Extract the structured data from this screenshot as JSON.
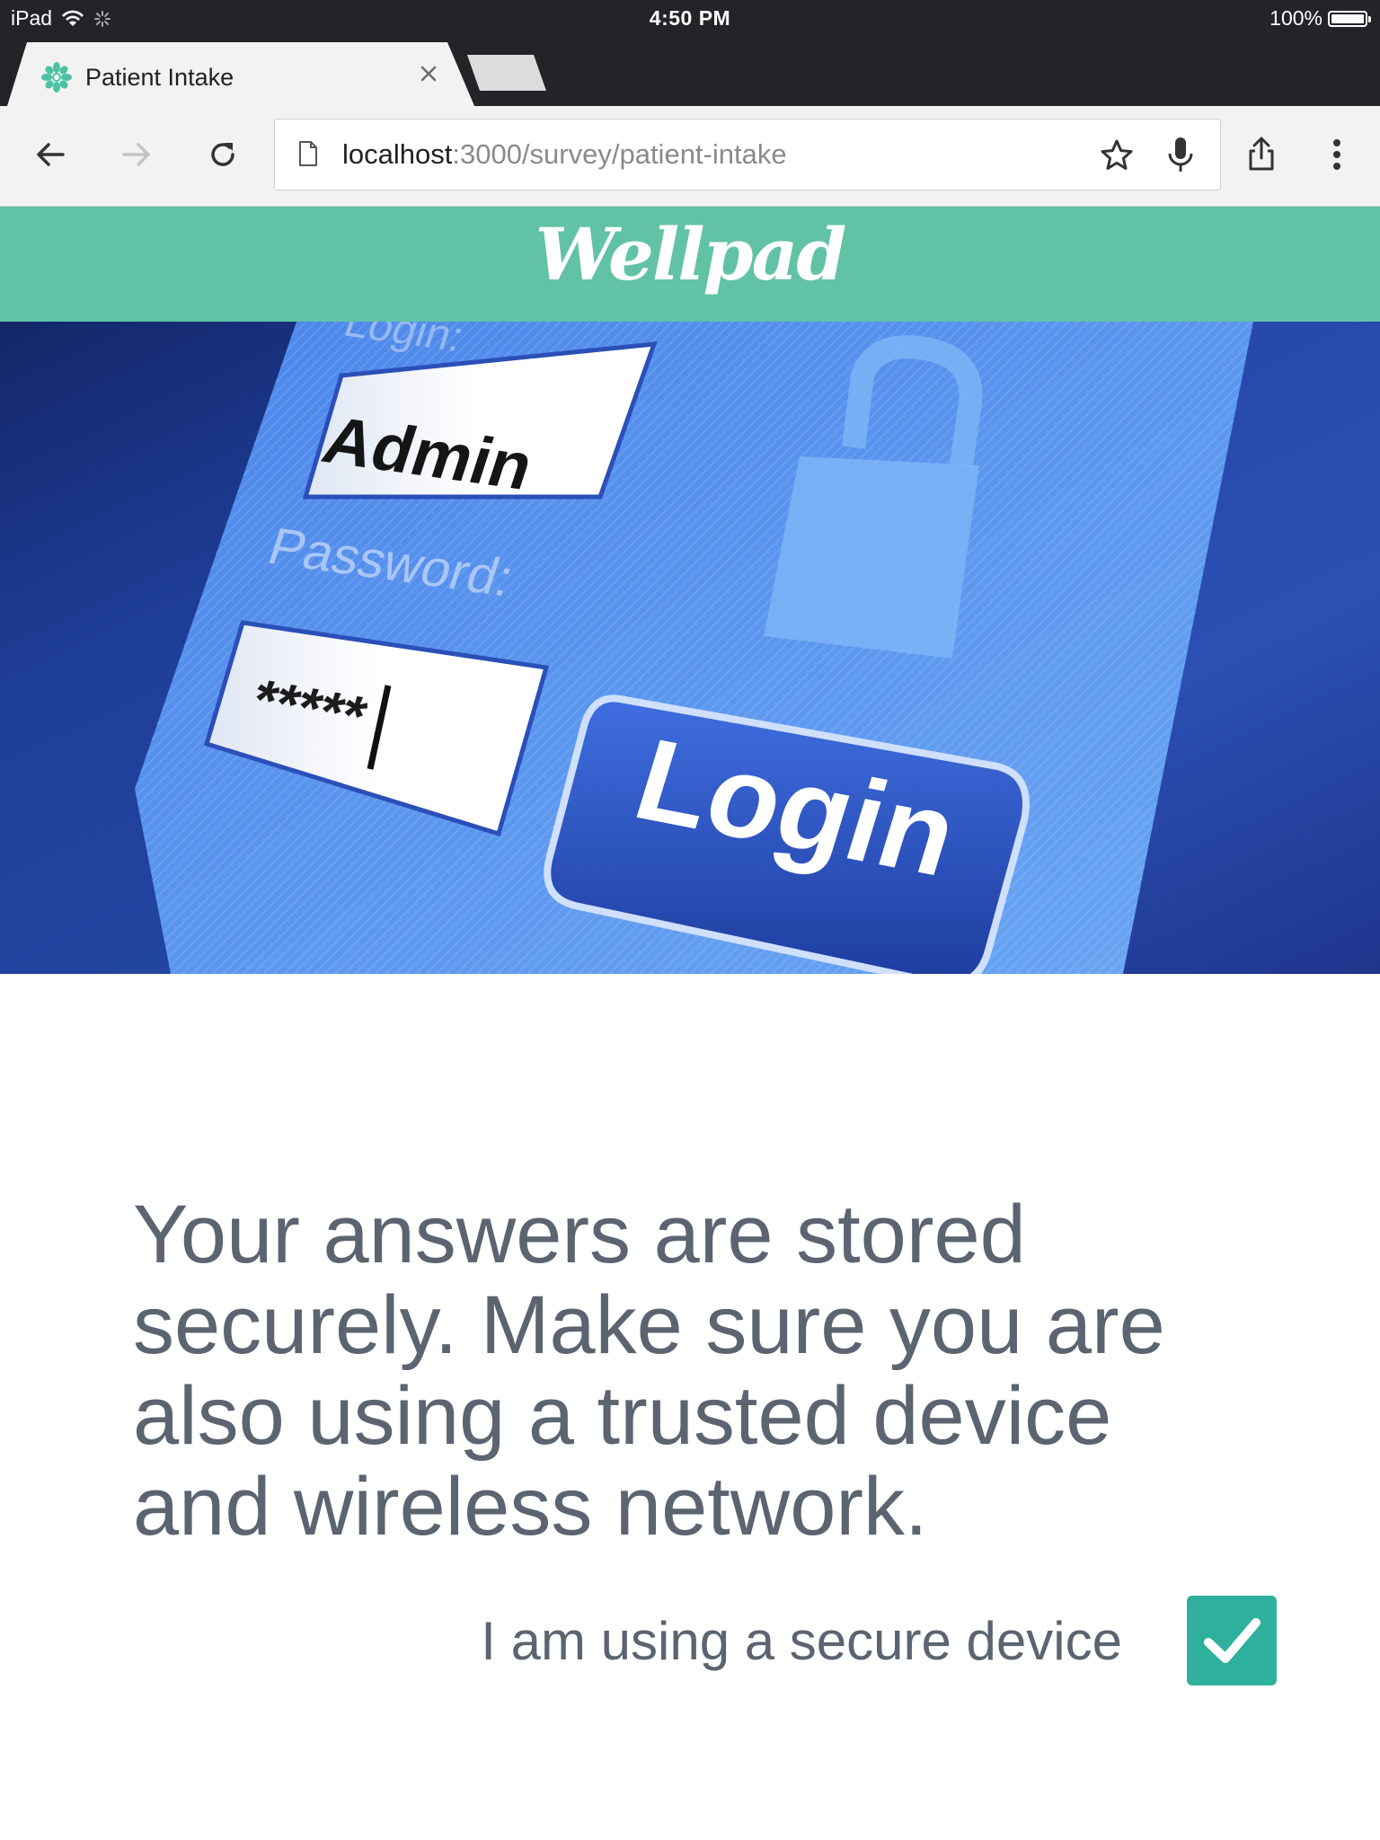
{
  "status_bar": {
    "device": "iPad",
    "time": "4:50 PM",
    "battery": "100%"
  },
  "browser": {
    "tab": {
      "title": "Patient Intake",
      "favicon": "wellpad-flower-icon"
    },
    "address_bar": {
      "host": "localhost",
      "path": ":3000/survey/patient-intake"
    },
    "icons": [
      "back-arrow-icon",
      "forward-arrow-icon",
      "reload-icon",
      "page-icon",
      "star-icon",
      "microphone-icon",
      "share-icon",
      "overflow-menu-icon"
    ]
  },
  "header": {
    "logo_text": "Wellpad",
    "background": "#62c2a6"
  },
  "hero": {
    "username_label": "Login:",
    "username_value": "Admin",
    "password_label": "Password:",
    "password_value": "*****",
    "button_label": "Login"
  },
  "main": {
    "message": "Your answers are stored securely. Make sure you are also using a trusted device and wireless network.",
    "consent_label": "I am using a secure device",
    "consent_checked": true,
    "accent": "#2fb09c"
  }
}
